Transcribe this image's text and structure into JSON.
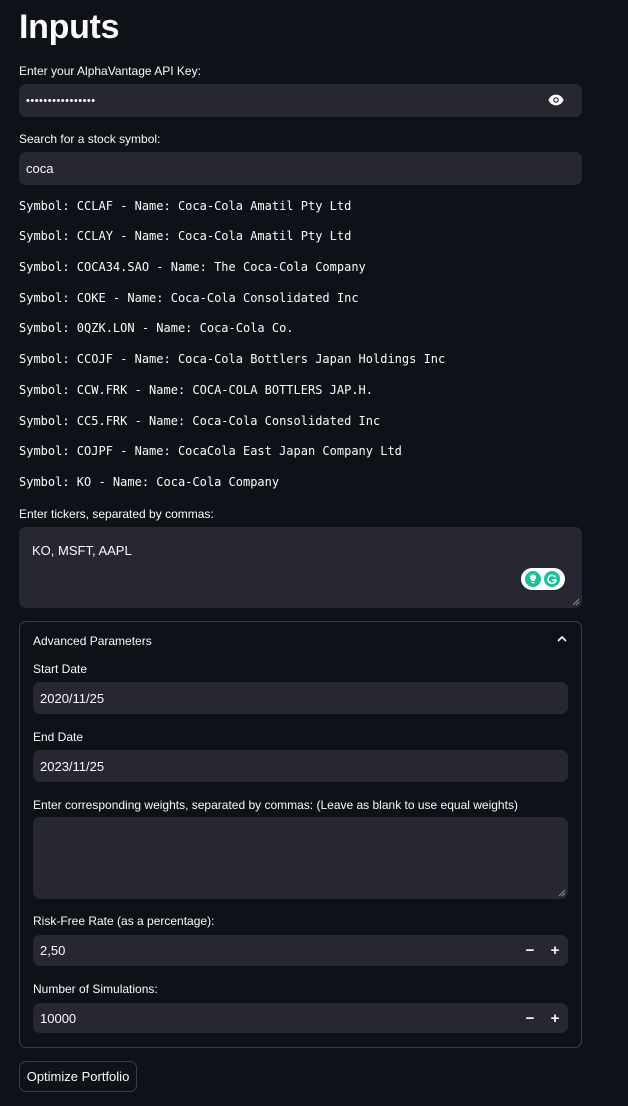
{
  "page": {
    "title": "Inputs"
  },
  "api_key": {
    "label": "Enter your AlphaVantage API Key:",
    "value": "••••••••••••••••"
  },
  "search": {
    "label": "Search for a stock symbol:",
    "value": "coca",
    "results": [
      "Symbol: CCLAF - Name: Coca-Cola Amatil Pty Ltd",
      "Symbol: CCLAY - Name: Coca-Cola Amatil Pty Ltd",
      "Symbol: COCA34.SAO - Name: The Coca-Cola Company",
      "Symbol: COKE - Name: Coca-Cola Consolidated Inc",
      "Symbol: 0QZK.LON - Name: Coca-Cola Co.",
      "Symbol: CCOJF - Name: Coca-Cola Bottlers Japan Holdings Inc",
      "Symbol: CCW.FRK - Name: COCA-COLA BOTTLERS JAP.H.",
      "Symbol: CC5.FRK - Name: Coca-Cola Consolidated Inc",
      "Symbol: COJPF - Name: CocaCola East Japan Company Ltd",
      "Symbol: KO - Name: Coca-Cola Company"
    ]
  },
  "tickers": {
    "label": "Enter tickers, separated by commas:",
    "value": "KO, MSFT, AAPL"
  },
  "advanced": {
    "title": "Advanced Parameters",
    "start_date": {
      "label": "Start Date",
      "value": "2020/11/25"
    },
    "end_date": {
      "label": "End Date",
      "value": "2023/11/25"
    },
    "weights": {
      "label": "Enter corresponding weights, separated by commas: (Leave as blank to use equal weights)",
      "value": ""
    },
    "risk_free": {
      "label": "Risk-Free Rate (as a percentage):",
      "value": "2,50",
      "minus": "−",
      "plus": "+"
    },
    "simulations": {
      "label": "Number of Simulations:",
      "value": "10000",
      "minus": "−",
      "plus": "+"
    }
  },
  "optimize_button": {
    "label": "Optimize Portfolio"
  },
  "colors": {
    "background": "#0e1117",
    "field": "#262730",
    "border": "#3a3d47",
    "grammarly": "#15c39a"
  }
}
